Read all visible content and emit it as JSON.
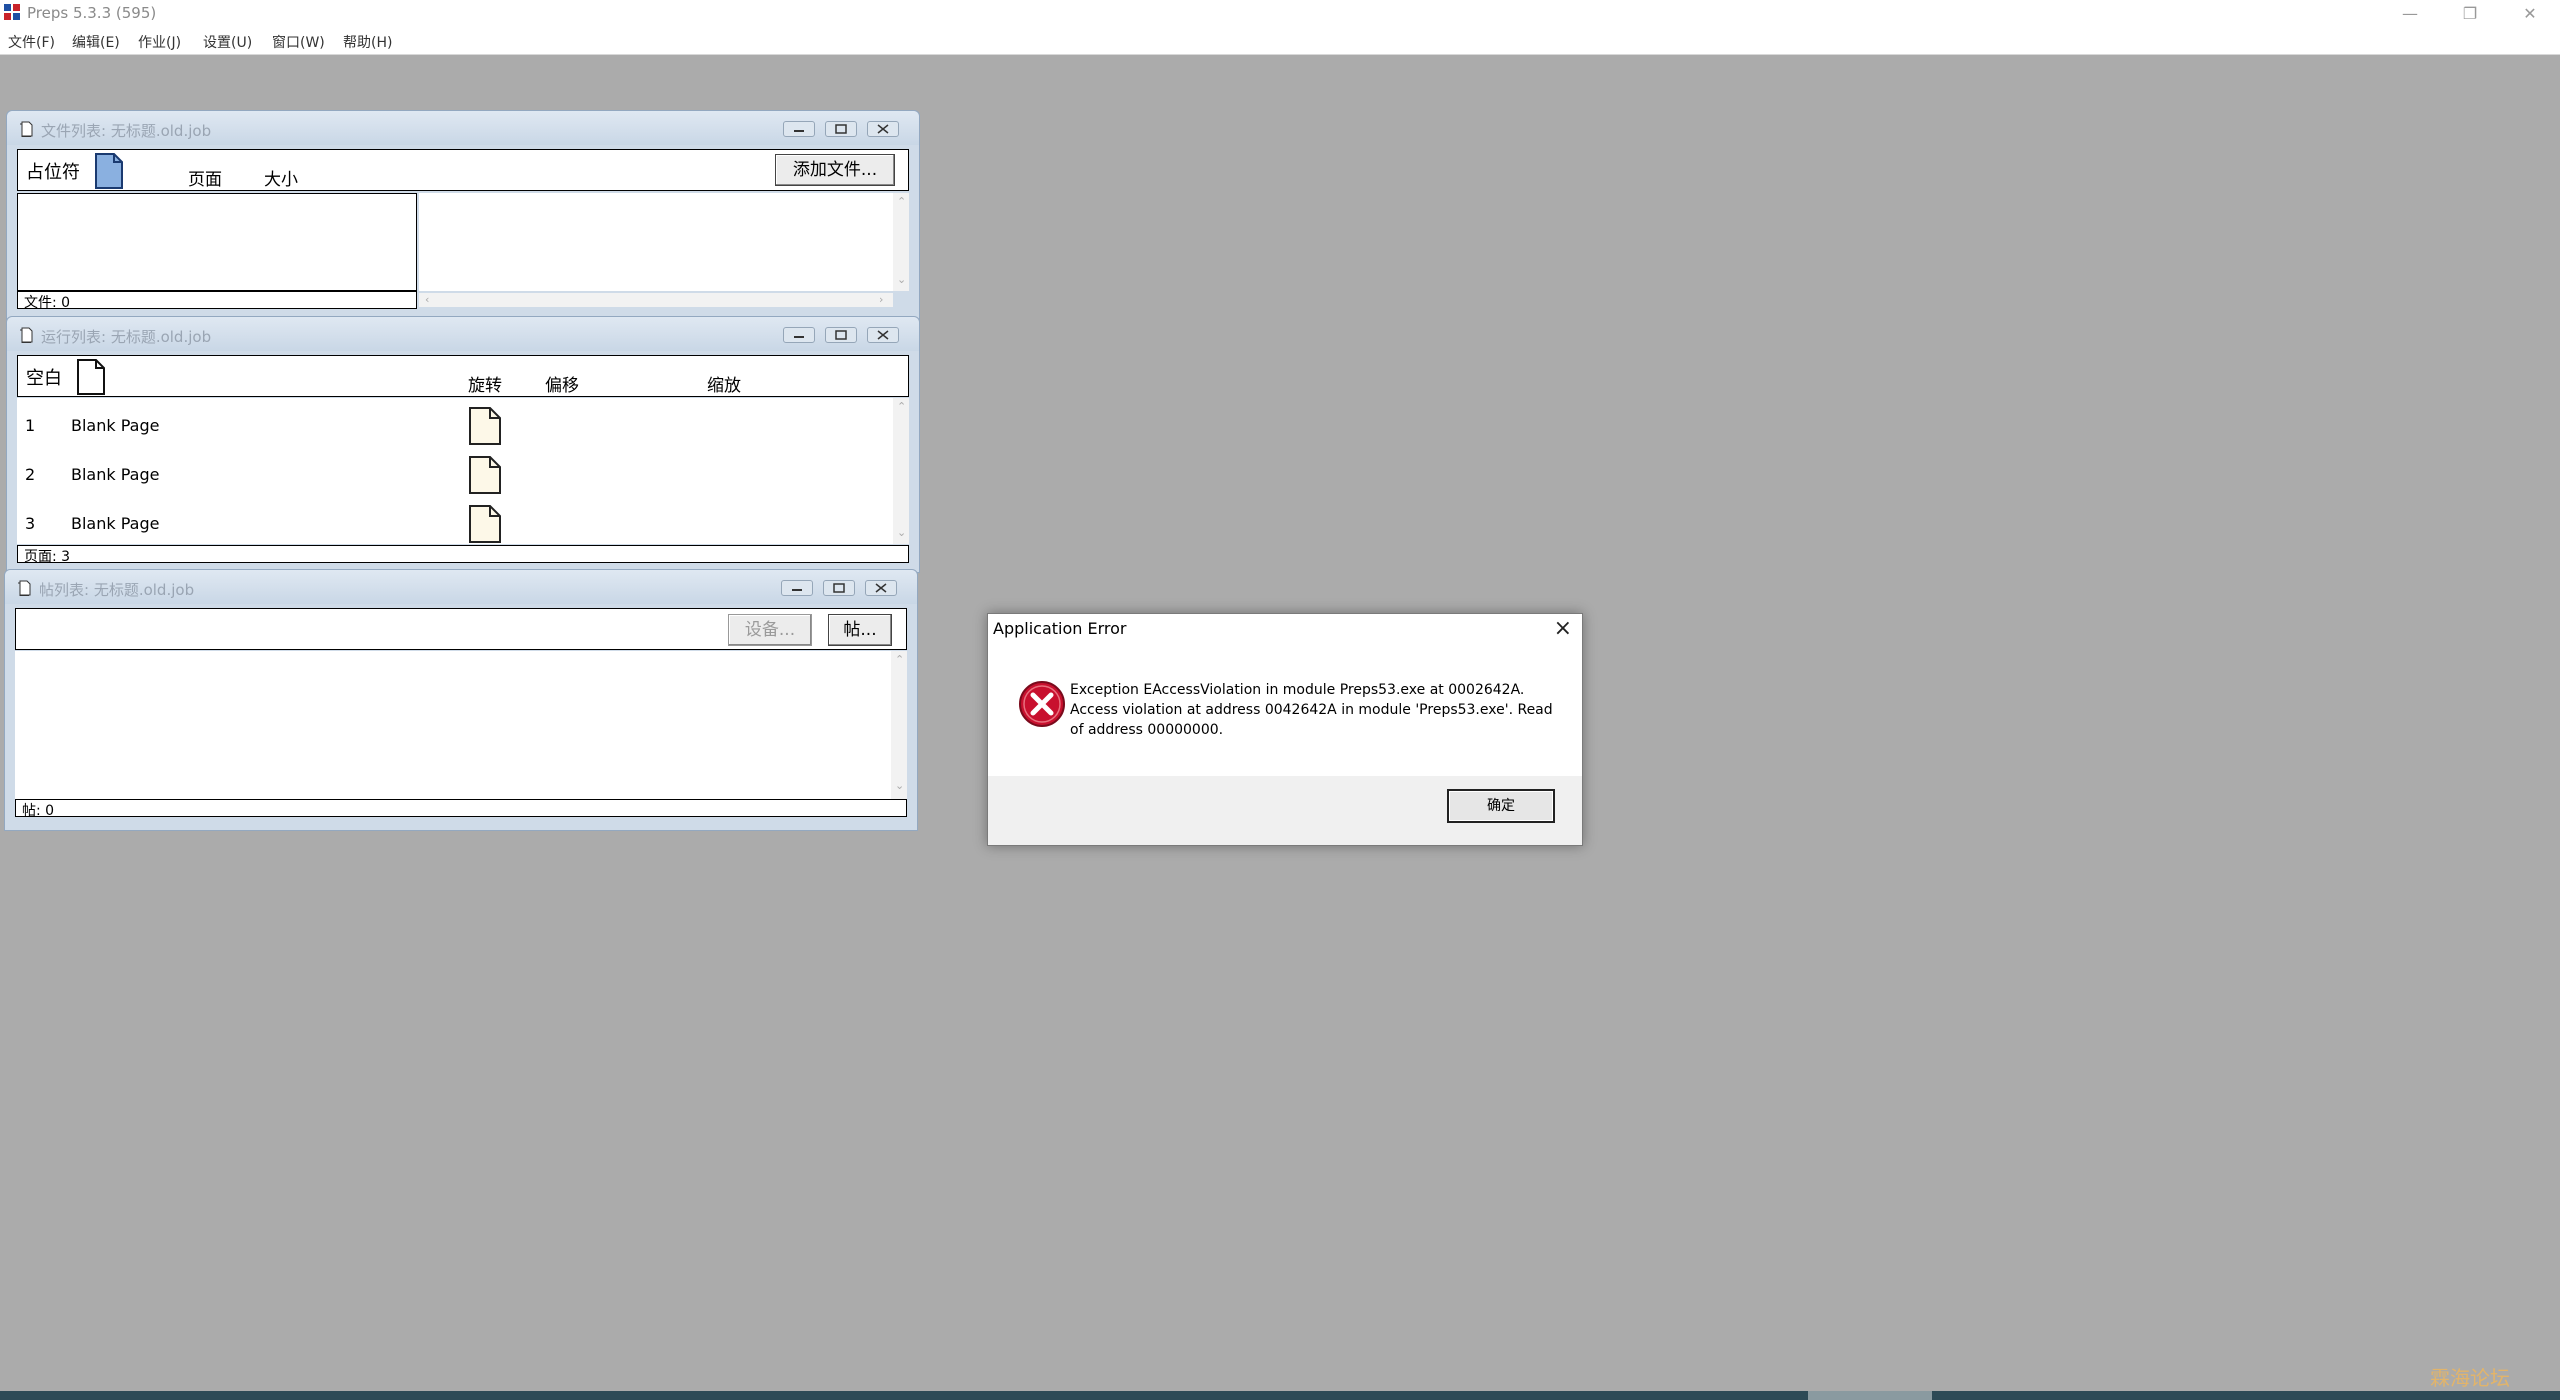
{
  "app": {
    "title": "Preps 5.3.3 (595)",
    "min_icon": "minimize-icon",
    "max_icon": "restore-icon",
    "close_icon": "close-icon"
  },
  "menu": [
    "文件(F)",
    "编辑(E)",
    "作业(J)",
    "设置(U)",
    "窗口(W)",
    "帮助(H)"
  ],
  "file_list": {
    "title": "文件列表: 无标题.old.job",
    "col_placeholder": "占位符",
    "col_page": "页面",
    "col_size": "大小",
    "add_button": "添加文件...",
    "status": "文件: 0"
  },
  "run_list": {
    "title": "运行列表: 无标题.old.job",
    "col_blank": "空白",
    "col_rotate": "旋转",
    "col_offset": "偏移",
    "col_scale": "缩放",
    "rows": [
      {
        "num": "1",
        "name": "Blank Page"
      },
      {
        "num": "2",
        "name": "Blank Page"
      },
      {
        "num": "3",
        "name": "Blank Page"
      }
    ],
    "status": "页面: 3"
  },
  "sig_list": {
    "title": "帖列表: 无标题.old.job",
    "settings_button": "设备...",
    "sig_button": "帖...",
    "status": "帖: 0"
  },
  "dialog": {
    "title": "Application Error",
    "line1": "Exception EAccessViolation in module Preps53.exe at 0002642A.",
    "line2": "Access violation at address 0042642A in module 'Preps53.exe'. Read of address 00000000.",
    "ok_button": "确定",
    "icon": "error-icon"
  },
  "watermark": "霖海论坛",
  "colors": {
    "desktop": "#ababab",
    "child_frame": "#cfdbe8",
    "error_red": "#c8102e"
  }
}
